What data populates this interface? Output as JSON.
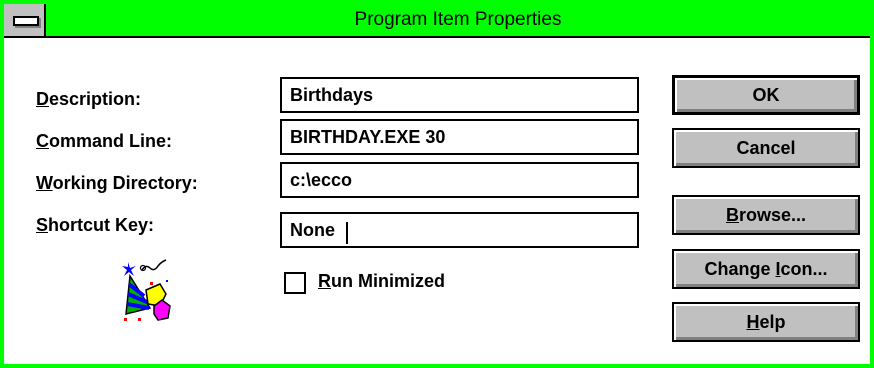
{
  "dialog": {
    "title": "Program Item Properties"
  },
  "fields": {
    "description": {
      "label_mnemonic": "D",
      "label_rest": "escription:",
      "value": "Birthdays"
    },
    "command_line": {
      "label_mnemonic": "C",
      "label_rest": "ommand Line:",
      "value": "BIRTHDAY.EXE 30"
    },
    "working_directory": {
      "label_mnemonic": "W",
      "label_rest": "orking Directory:",
      "value": "c:\\ecco"
    },
    "shortcut_key": {
      "label_mnemonic": "S",
      "label_rest": "hortcut Key:",
      "value": "None"
    }
  },
  "run_minimized": {
    "label_mnemonic": "R",
    "label_rest": "un Minimized",
    "checked": false
  },
  "buttons": {
    "ok": {
      "label": "OK"
    },
    "cancel": {
      "label": "Cancel"
    },
    "browse": {
      "mnemonic": "B",
      "rest": "rowse..."
    },
    "change_icon": {
      "before": "Change ",
      "mnemonic": "I",
      "rest": "con..."
    },
    "help": {
      "mnemonic": "H",
      "rest": "elp"
    }
  },
  "icon": {
    "name": "party-hat-icon"
  },
  "colors": {
    "titlebar": "#00ff00",
    "frame": "#00ff00",
    "button_face": "#c0c0c0"
  }
}
